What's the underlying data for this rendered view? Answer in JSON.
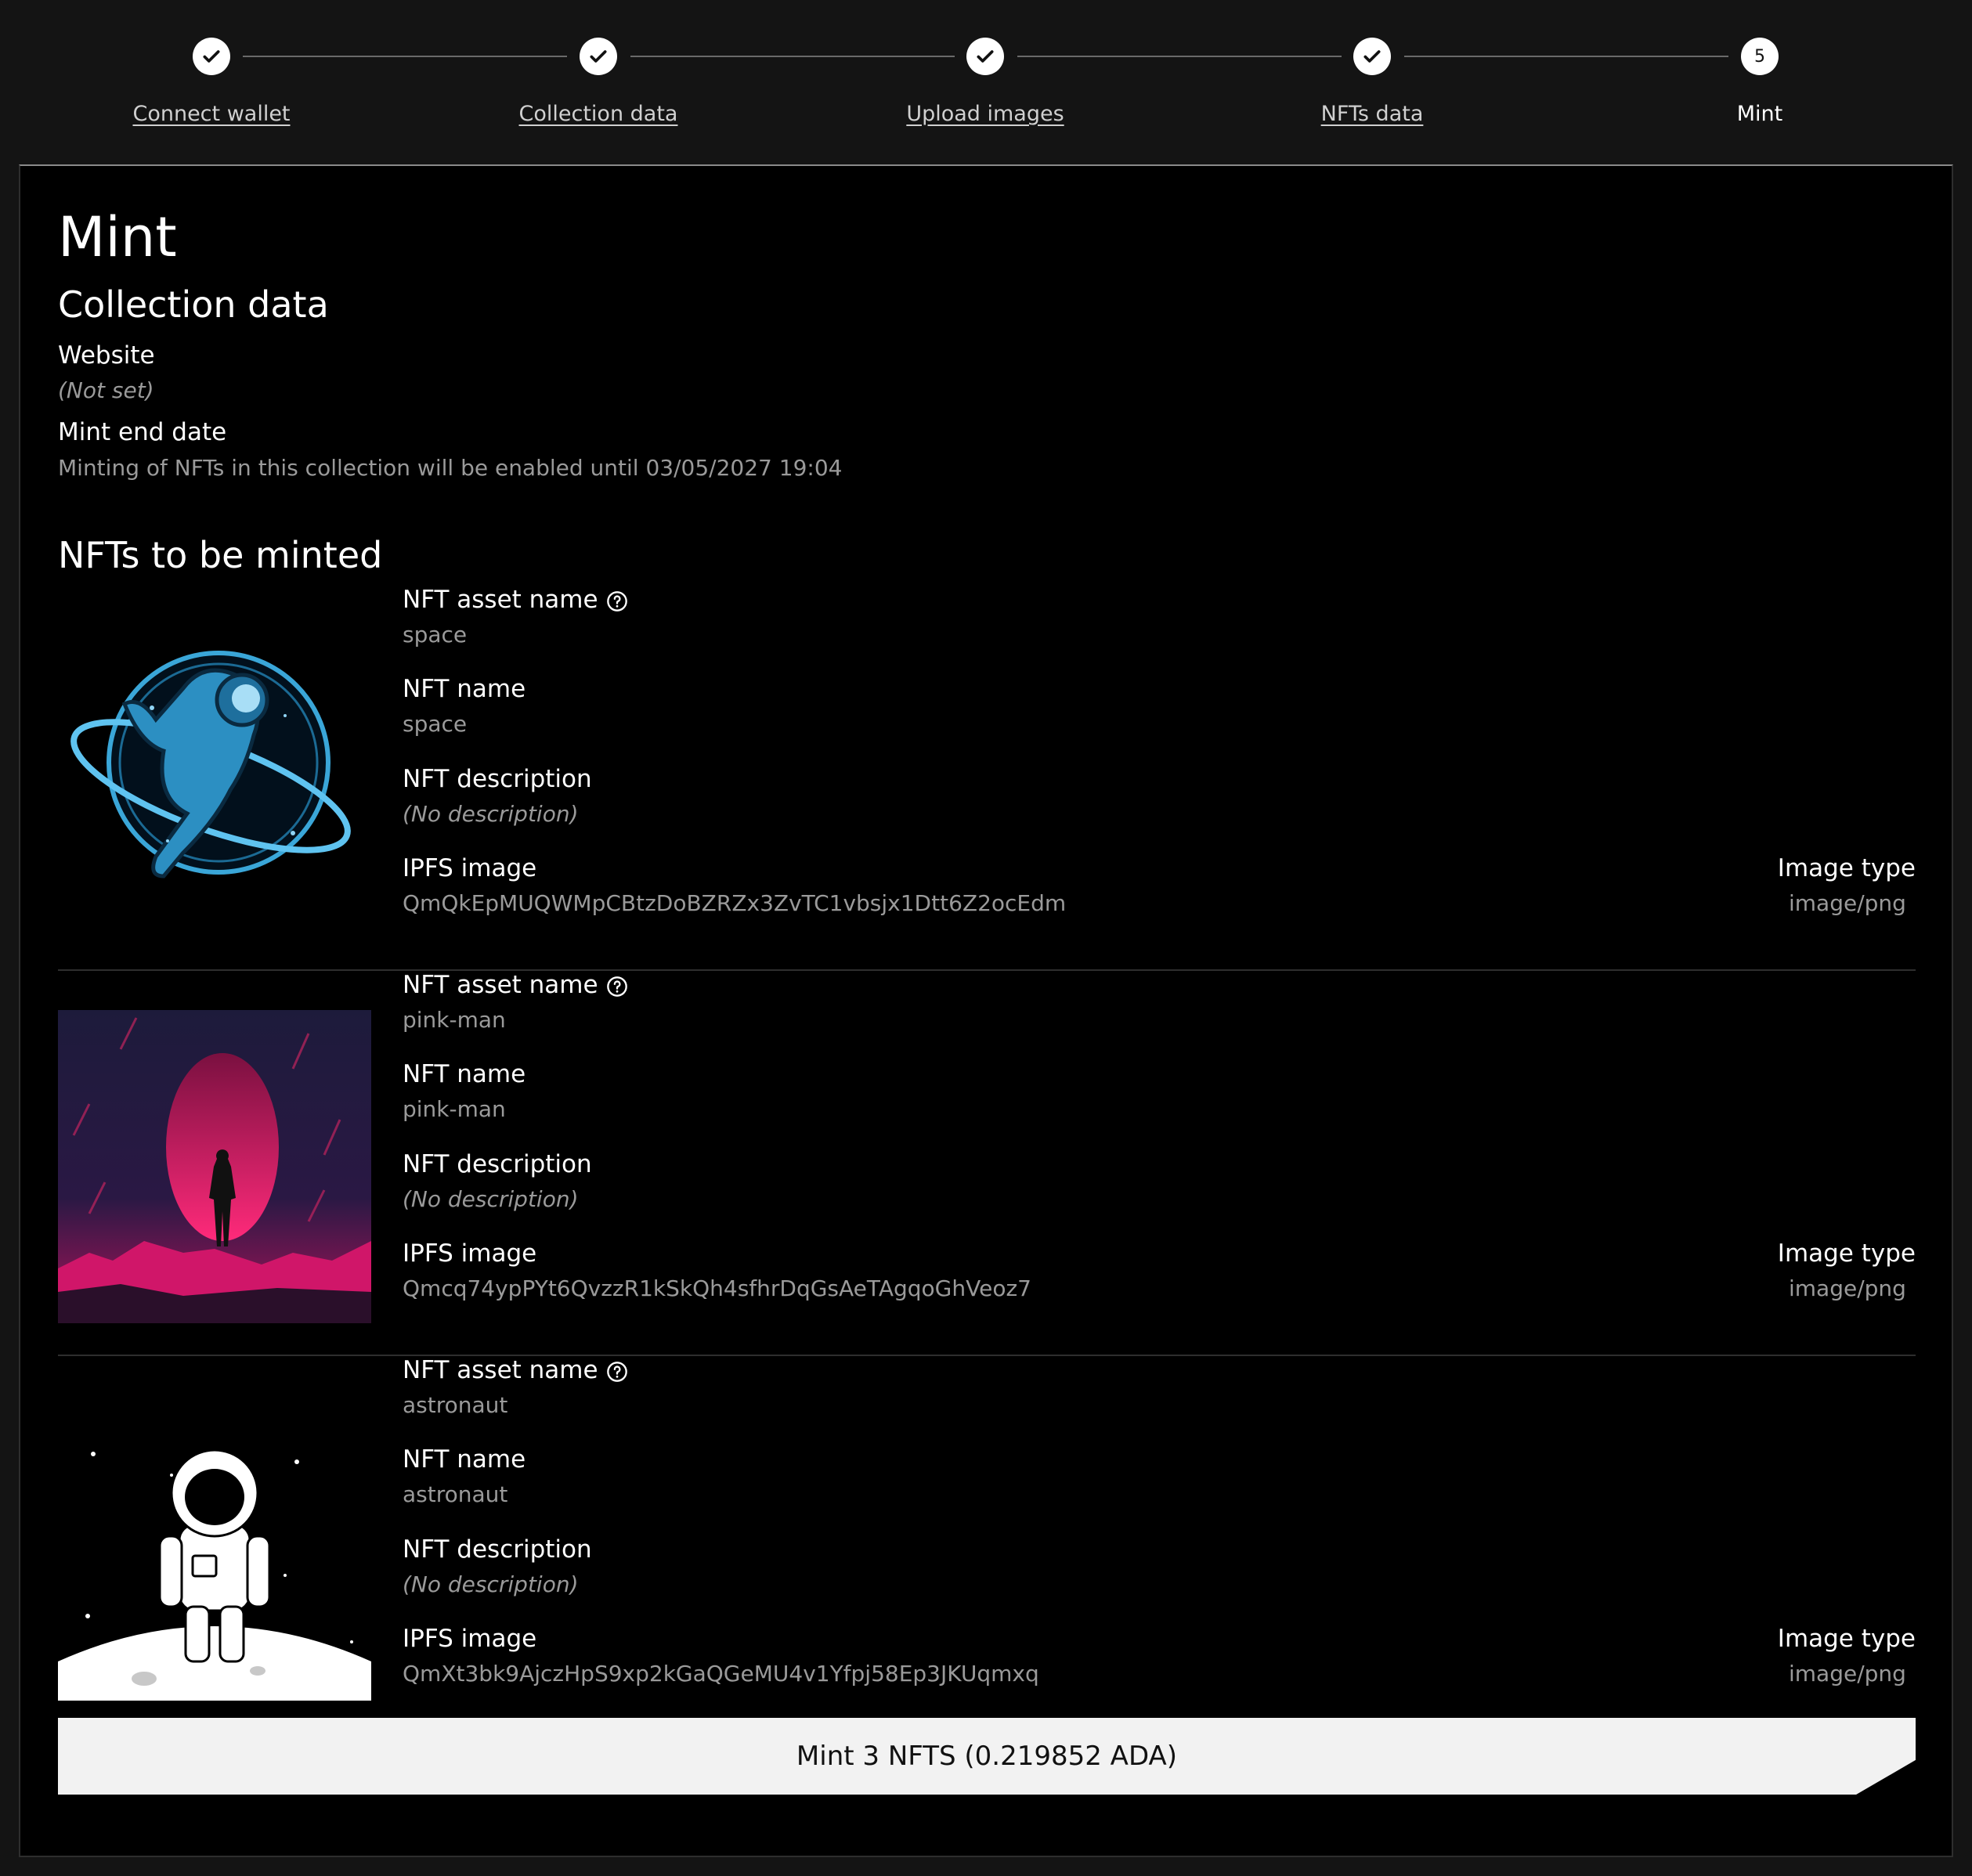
{
  "stepper": {
    "steps": [
      {
        "label": "Connect wallet",
        "status": "done"
      },
      {
        "label": "Collection data",
        "status": "done"
      },
      {
        "label": "Upload images",
        "status": "done"
      },
      {
        "label": "NFTs data",
        "status": "done"
      },
      {
        "label": "Mint",
        "status": "current",
        "number": "5"
      }
    ]
  },
  "page": {
    "title": "Mint",
    "collection_heading": "Collection data",
    "website_label": "Website",
    "website_value": "(Not set)",
    "mint_end_label": "Mint end date",
    "mint_end_value": "Minting of NFTs in this collection will be enabled until 03/05/2027 19:04",
    "nfts_heading": "NFTs to be minted"
  },
  "field_labels": {
    "asset_name": "NFT asset name",
    "name": "NFT name",
    "description": "NFT description",
    "ipfs": "IPFS image",
    "image_type": "Image type"
  },
  "nfts": [
    {
      "asset_name": "space",
      "name": "space",
      "description": "(No description)",
      "ipfs": "QmQkEpMUQWMpCBtzDoBZRZx3ZvTC1vbsjx1Dtt6Z2ocEdm",
      "image_type": "image/png",
      "image": "space-astronaut-illustration"
    },
    {
      "asset_name": "pink-man",
      "name": "pink-man",
      "description": "(No description)",
      "ipfs": "Qmcq74ypPYt6QvzzR1kSkQh4sfhrDqGsAeTAgqoGhVeoz7",
      "image_type": "image/png",
      "image": "pink-planet-silhouette-illustration"
    },
    {
      "asset_name": "astronaut",
      "name": "astronaut",
      "description": "(No description)",
      "ipfs": "QmXt3bk9AjczHpS9xp2kGaQGeMU4v1Yfpj58Ep3JKUqmxq",
      "image_type": "image/png",
      "image": "astronaut-on-moon-illustration"
    }
  ],
  "mint_button": {
    "label": "Mint 3 NFTS (0.219852 ADA)"
  },
  "colors": {
    "background": "#141414",
    "panel": "#000000",
    "muted_text": "#9a9a9a",
    "button": "#f2f2f2"
  }
}
